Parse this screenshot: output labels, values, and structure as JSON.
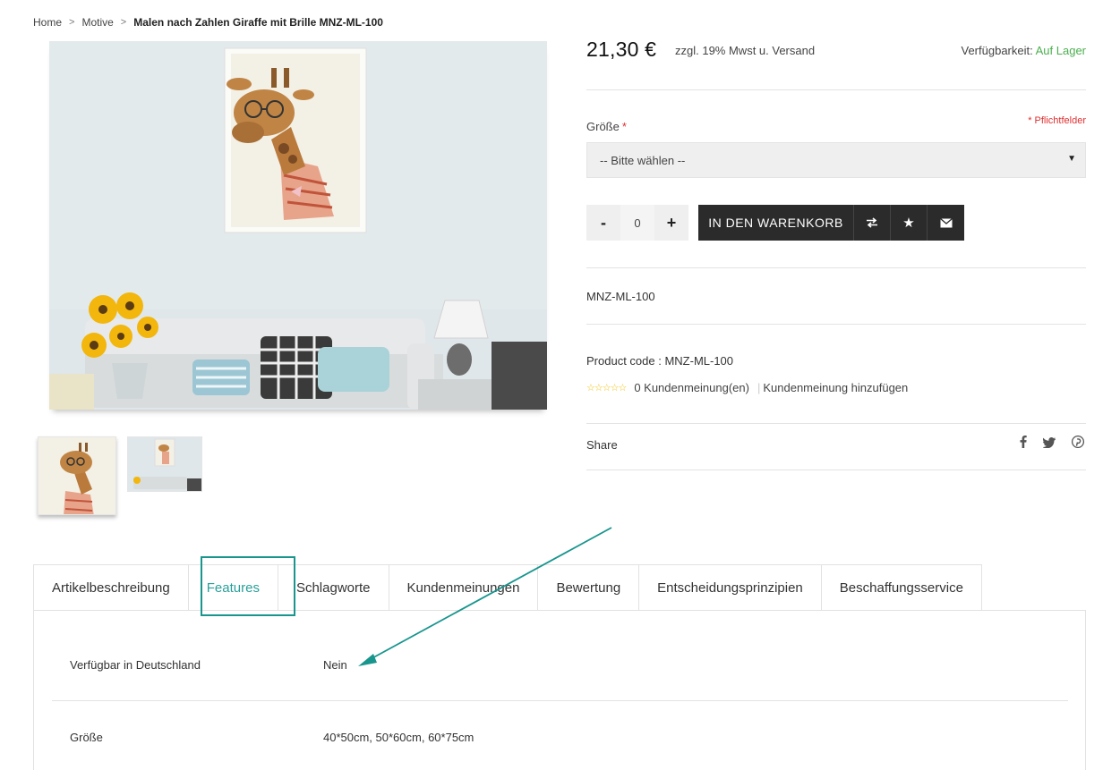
{
  "breadcrumb": {
    "items": [
      "Home",
      "Motive"
    ],
    "current": "Malen nach Zahlen Giraffe mit Brille MNZ-ML-100",
    "separator": ">"
  },
  "product": {
    "price": "21,30 €",
    "tax_note": "zzgl. 19% Mwst u. Versand",
    "availability_label": "Verfügbarkeit:",
    "availability_value": "Auf Lager",
    "sku": "MNZ-ML-100",
    "code_label": "Product code :",
    "code_value": "MNZ-ML-100"
  },
  "options": {
    "size_label": "Größe",
    "required_marker": "*",
    "required_note": "* Pflichtfelder",
    "size_select": "-- Bitte wählen --"
  },
  "cart": {
    "minus": "-",
    "quantity": "0",
    "plus": "+",
    "add_to_cart": "IN DEN WARENKORB",
    "compare_icon": "compare-icon",
    "wishlist_icon": "star-icon",
    "email_icon": "envelope-icon"
  },
  "reviews": {
    "count_text": "0 Kundenmeinung(en)",
    "add_text": "Kundenmeinung hinzufügen",
    "stars": "☆☆☆☆☆"
  },
  "share": {
    "label": "Share",
    "icons": [
      "facebook-icon",
      "twitter-icon",
      "pinterest-icon"
    ]
  },
  "tabs": [
    {
      "label": "Artikelbeschreibung"
    },
    {
      "label": "Features"
    },
    {
      "label": "Schlagworte"
    },
    {
      "label": "Kundenmeinungen"
    },
    {
      "label": "Bewertung"
    },
    {
      "label": "Entscheidungsprinzipien"
    },
    {
      "label": "Beschaffungsservice"
    }
  ],
  "active_tab": "Features",
  "features": [
    {
      "name": "Verfügbar in Deutschland",
      "value": "Nein"
    },
    {
      "name": "Größe",
      "value": "40*50cm, 50*60cm, 60*75cm"
    }
  ],
  "colors": {
    "accent": "#2aa09a",
    "annotation": "#18958d",
    "in_stock": "#4caf50",
    "required": "#e03030",
    "button_dark": "#2b2b2b"
  }
}
